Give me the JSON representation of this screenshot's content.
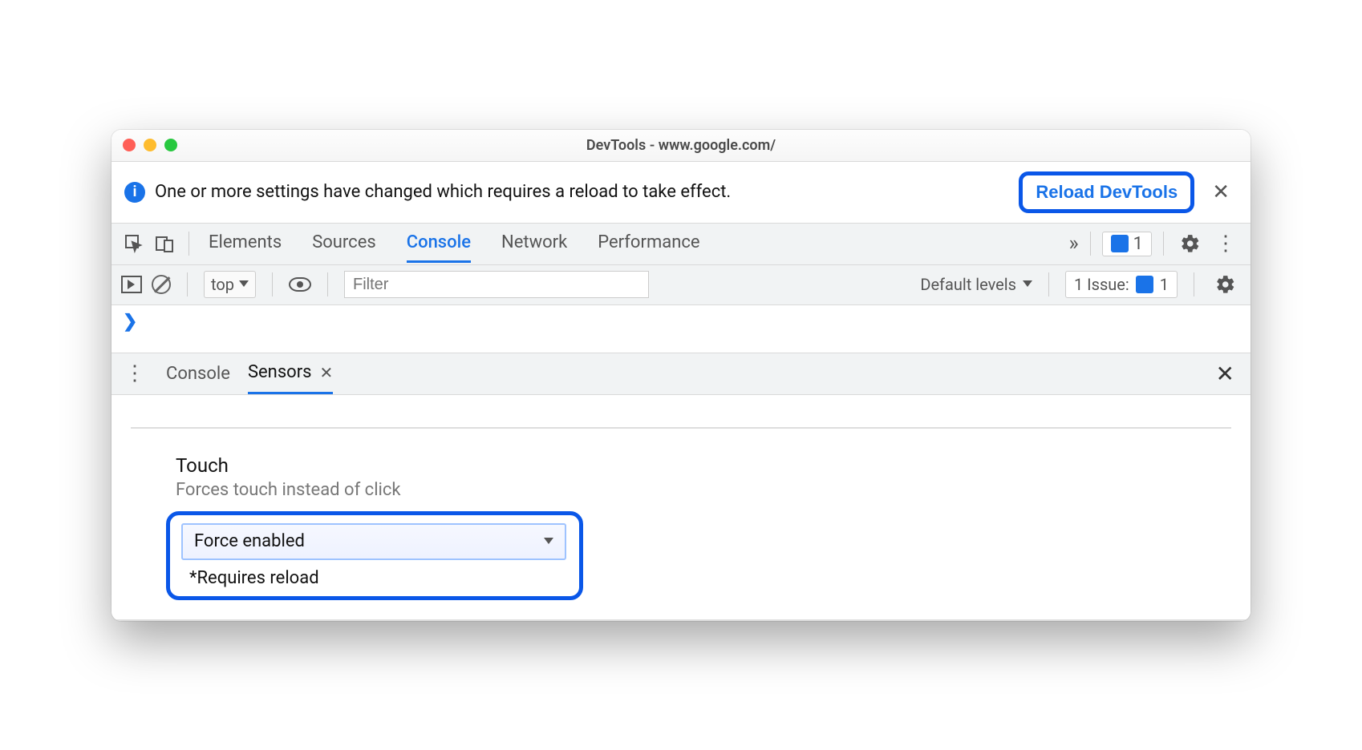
{
  "window": {
    "title": "DevTools - www.google.com/"
  },
  "infobar": {
    "message": "One or more settings have changed which requires a reload to take effect.",
    "button": "Reload DevTools"
  },
  "toolbar": {
    "tabs": [
      "Elements",
      "Sources",
      "Console",
      "Network",
      "Performance"
    ],
    "active_tab": "Console",
    "issue_count": "1"
  },
  "consolebar": {
    "context": "top",
    "filter_placeholder": "Filter",
    "levels": "Default levels",
    "issues_label": "1 Issue:",
    "issues_count": "1"
  },
  "drawer": {
    "tabs": [
      "Console",
      "Sensors"
    ],
    "active_tab": "Sensors"
  },
  "sensors": {
    "touch": {
      "title": "Touch",
      "description": "Forces touch instead of click",
      "selected": "Force enabled",
      "note": "*Requires reload"
    }
  }
}
